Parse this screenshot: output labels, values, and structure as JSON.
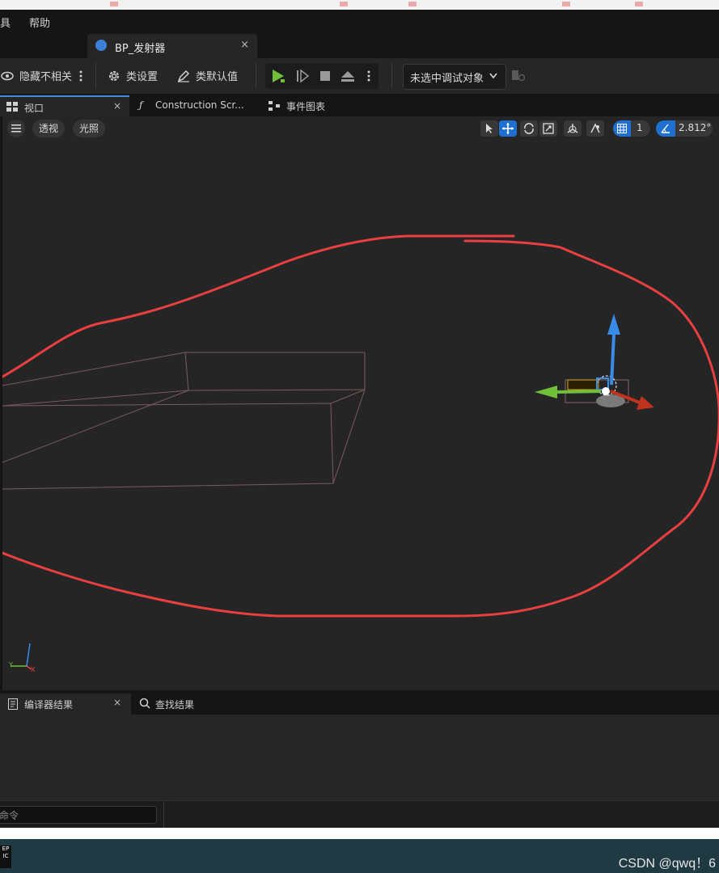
{
  "menu": {
    "items": [
      "具",
      "帮助"
    ]
  },
  "document_tab": {
    "title": "BP_发射器",
    "close": "×"
  },
  "toolbar": {
    "hide_unrelated": "隐藏不相关",
    "class_settings": "类设置",
    "class_defaults": "类默认值",
    "debug_target": "未选中调试对象"
  },
  "panel_tabs": {
    "viewport": "视口",
    "construction": "Construction Scr...",
    "event_graph": "事件图表",
    "close": "×"
  },
  "viewport": {
    "perspective": "透视",
    "lighting": "光照",
    "grid_snap": "1",
    "rotation_snap": "2.812°",
    "axis_y": "Y",
    "axis_x": "X"
  },
  "bottom_tabs": {
    "compiler_results": "编译器结果",
    "find_results": "查找结果",
    "close": "×"
  },
  "command": {
    "placeholder": "命令"
  },
  "watermark": "CSDN @qwq！6",
  "colors": {
    "accent": "#1f6fd0",
    "annotation": "#e84040",
    "play": "#6fbf3a"
  }
}
